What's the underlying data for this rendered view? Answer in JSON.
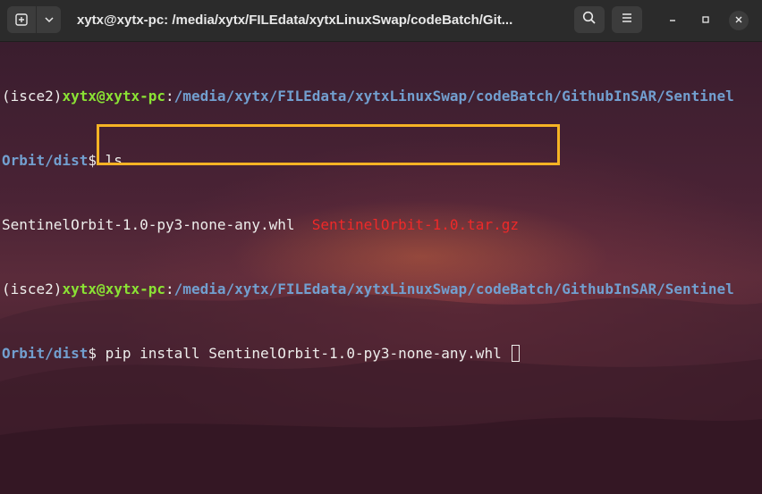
{
  "window": {
    "title": "xytx@xytx-pc: /media/xytx/FILEdata/xytxLinuxSwap/codeBatch/Git...",
    "new_tab_icon": "new-tab-icon",
    "menu_icons": [
      "chevron-down-icon",
      "search-icon",
      "hamburger-menu-icon",
      "minimize-icon",
      "maximize-icon",
      "close-icon"
    ]
  },
  "terminal": {
    "lines": [
      {
        "env": "(isce2)",
        "user": "xytx@xytx-pc",
        "sep": ":",
        "path": "/media/xytx/FILEdata/xytxLinuxSwap/codeBatch/GithubInSAR/Sentinel"
      },
      {
        "path": "Orbit/dist",
        "prompt": "$ ",
        "command": "ls"
      },
      {
        "file1": "SentinelOrbit-1.0-py3-none-any.whl",
        "gap": "  ",
        "file2": "SentinelOrbit-1.0.tar.gz"
      },
      {
        "env": "(isce2)",
        "user": "xytx@xytx-pc",
        "sep": ":",
        "path": "/media/xytx/FILEdata/xytxLinuxSwap/codeBatch/GithubInSAR/Sentinel"
      },
      {
        "path": "Orbit/dist",
        "prompt": "$ ",
        "command": "pip install SentinelOrbit-1.0-py3-none-any.whl "
      }
    ]
  },
  "colors": {
    "user_green": "#8ae234",
    "path_blue": "#729fcf",
    "archive_red": "#ef2929",
    "highlight_yellow": "#f5b324",
    "titlebar_bg": "#2b2b2b"
  }
}
